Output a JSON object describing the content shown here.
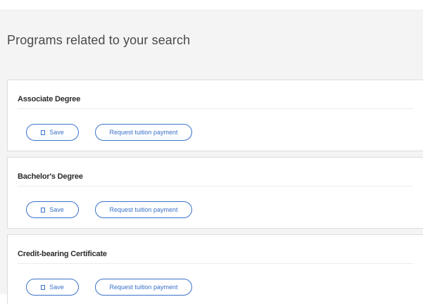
{
  "page": {
    "title": "Programs related to your search"
  },
  "programs": [
    {
      "name": "Associate Degree",
      "save_label": "Save",
      "tuition_label": "Request tuition payment"
    },
    {
      "name": "Bachelor's Degree",
      "save_label": "Save",
      "tuition_label": "Request tuition payment"
    },
    {
      "name": "Credit-bearing Certificate",
      "save_label": "Save",
      "tuition_label": "Request tuition payment"
    }
  ],
  "icons": {
    "save": "bookmark-icon"
  },
  "colors": {
    "accent": "#3a71c9",
    "panel_background": "#f4f4f4",
    "card_background": "#ffffff"
  }
}
